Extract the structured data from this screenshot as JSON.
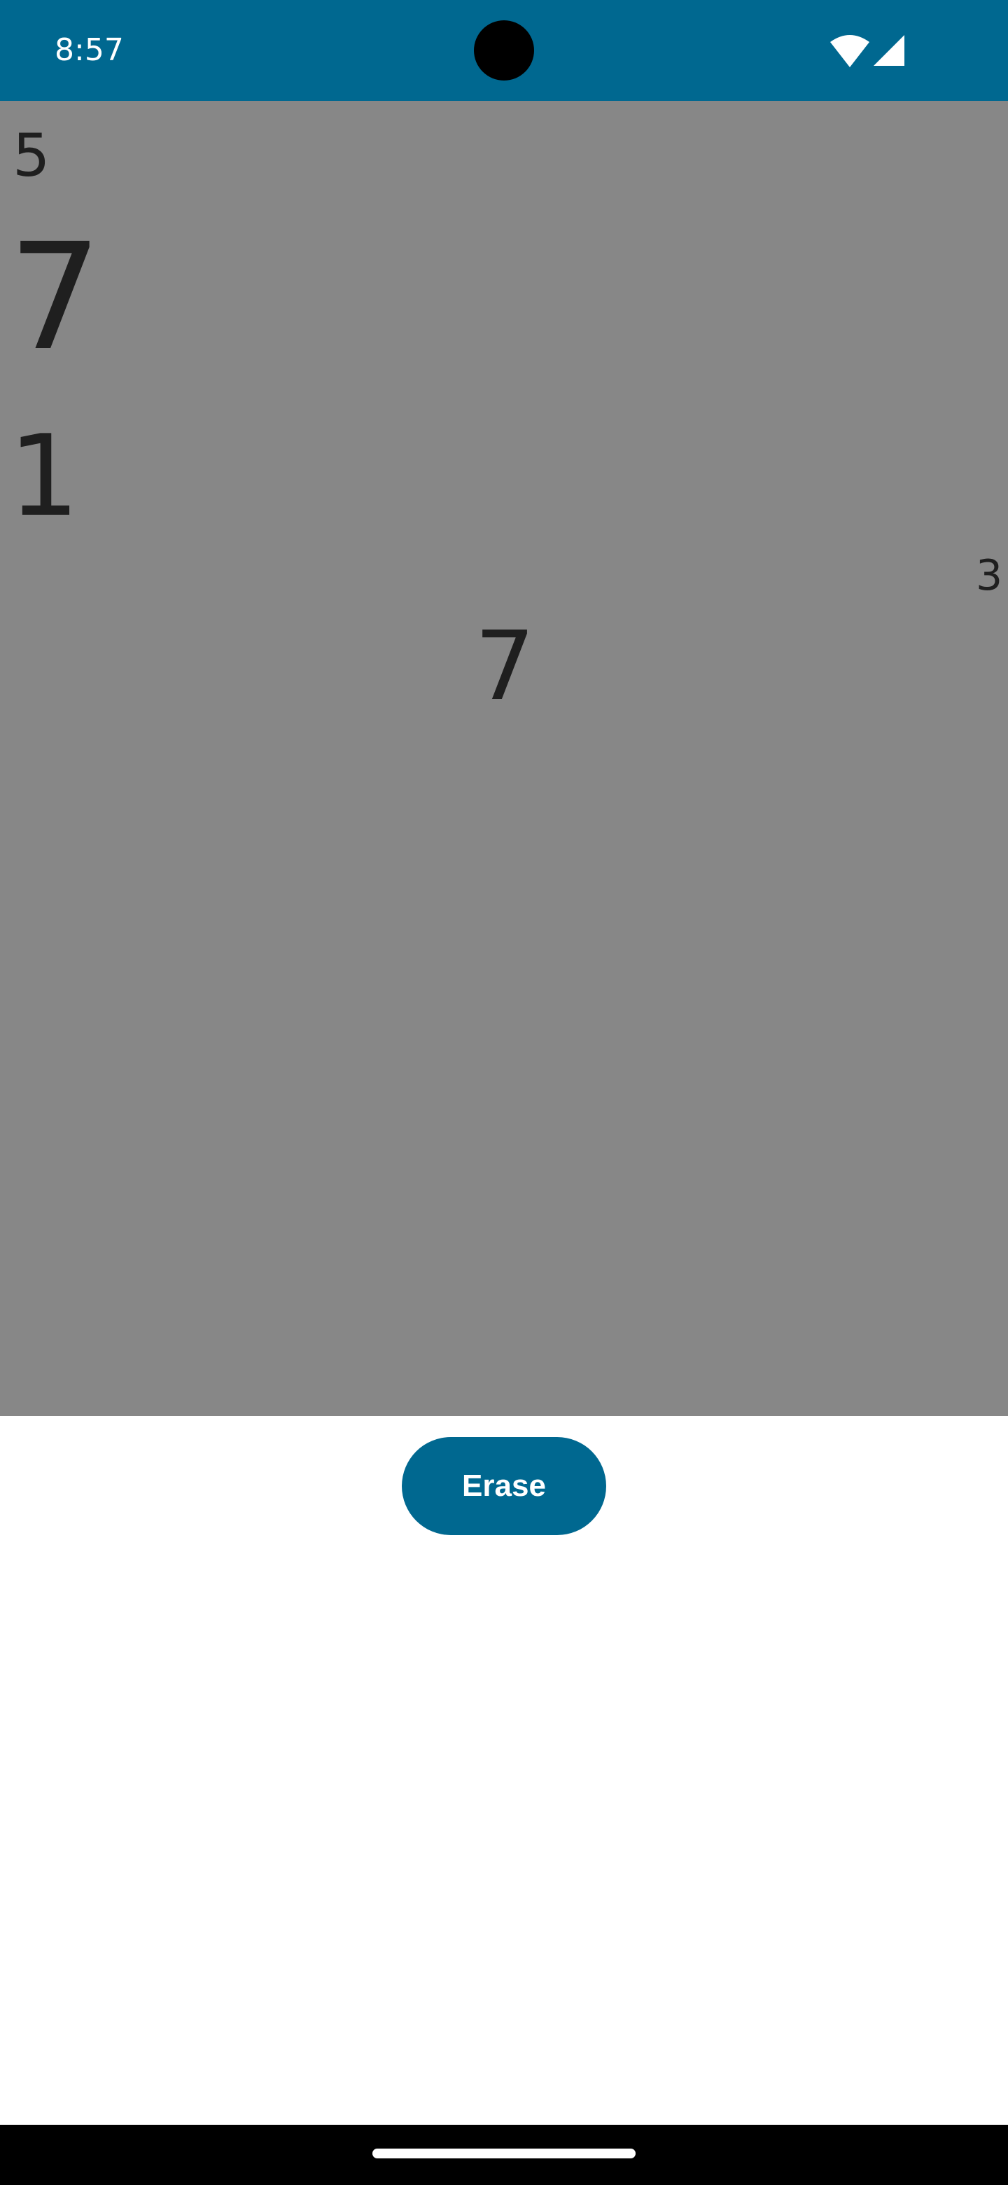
{
  "status_bar": {
    "time": "8:57",
    "background_color": "#006890",
    "icons": [
      "wifi-icon",
      "signal-icon"
    ]
  },
  "canvas": {
    "background_color": "#878787",
    "digits": [
      "5",
      "7",
      "1",
      "3",
      "7"
    ]
  },
  "erase_button": {
    "label": "Erase",
    "color": "#006890"
  },
  "nav_bar": {
    "icons": [
      "home-indicator"
    ]
  }
}
